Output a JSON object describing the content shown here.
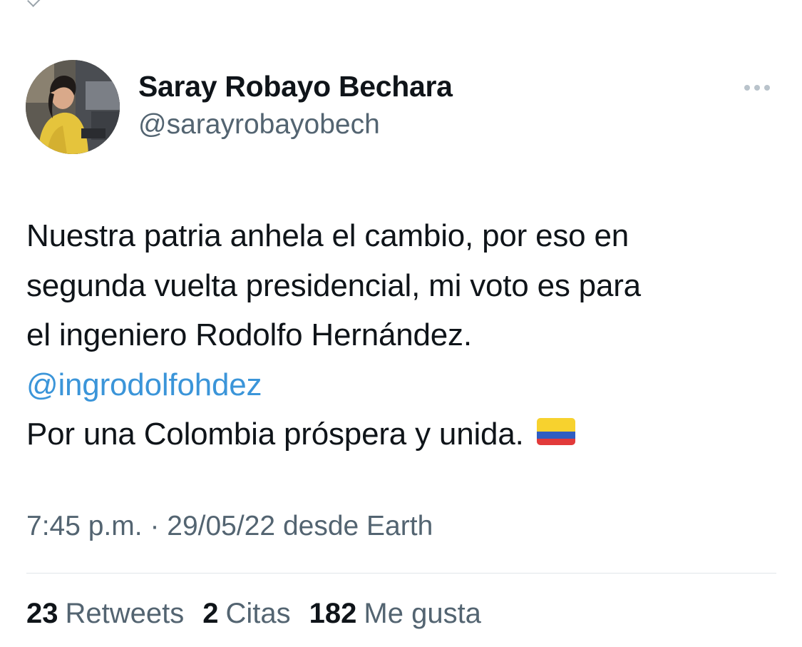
{
  "author": {
    "display_name": "Saray Robayo Bechara",
    "handle": "@sarayrobayobech",
    "avatar_icon": "profile-photo"
  },
  "more_icon": "more-horizontal-icon",
  "tweet": {
    "line1": "Nuestra patria anhela el cambio, por eso en",
    "line2": "segunda vuelta presidencial, mi voto es para",
    "line3": "el ingeniero Rodolfo Hernández.",
    "mention": "@ingrodolfohdez",
    "line5": "Por una Colombia próspera y unida.",
    "emoji": "colombia-flag-emoji"
  },
  "meta": {
    "time": "7:45 p.m.",
    "separator": "·",
    "date": "29/05/22",
    "source_prefix": "desde",
    "source": "Earth"
  },
  "stats": {
    "retweets_count": "23",
    "retweets_label": "Retweets",
    "quotes_count": "2",
    "quotes_label": "Citas",
    "likes_count": "182",
    "likes_label": "Me gusta"
  },
  "colors": {
    "text": "#0f1419",
    "secondary": "#536471",
    "link": "#3b95d9",
    "divider": "#e1e6ea"
  }
}
